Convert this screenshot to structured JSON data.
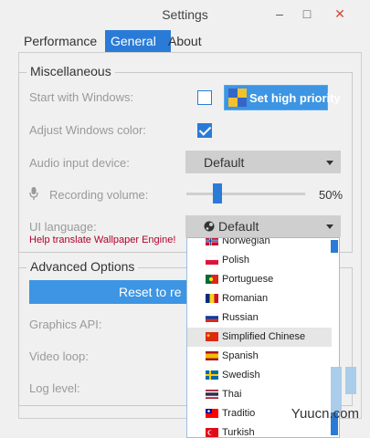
{
  "window": {
    "title": "Settings",
    "minimize": "–",
    "maximize": "□",
    "close": "✕"
  },
  "tabs": [
    {
      "label": "Performance",
      "active": false
    },
    {
      "label": "General",
      "active": true
    },
    {
      "label": "About",
      "active": false
    }
  ],
  "misc": {
    "legend": "Miscellaneous",
    "start_with_windows": {
      "label": "Start with Windows:",
      "checked": false
    },
    "high_priority_button": "Set high priority",
    "adjust_color": {
      "label": "Adjust Windows color:",
      "checked": true
    },
    "audio_device": {
      "label": "Audio input device:",
      "value": "Default"
    },
    "recording_volume": {
      "label": "Recording volume:",
      "value_text": "50%",
      "value": 0.26
    },
    "ui_language": {
      "label": "UI language:",
      "value": "Default"
    },
    "help_link": "Help translate Wallpaper Engine!"
  },
  "advanced": {
    "legend": "Advanced Options",
    "reset_button": "Reset to re",
    "graphics_api": "Graphics API:",
    "video_loop": "Video loop:",
    "log_level": "Log level:"
  },
  "language_list": {
    "items": [
      {
        "label": "Norwegian",
        "flag": "norway-flag"
      },
      {
        "label": "Polish",
        "flag": "poland-flag"
      },
      {
        "label": "Portuguese",
        "flag": "portugal-flag"
      },
      {
        "label": "Romanian",
        "flag": "romania-flag"
      },
      {
        "label": "Russian",
        "flag": "russia-flag"
      },
      {
        "label": "Simplified Chinese",
        "flag": "china-flag",
        "highlighted": true
      },
      {
        "label": "Spanish",
        "flag": "spain-flag"
      },
      {
        "label": "Swedish",
        "flag": "sweden-flag"
      },
      {
        "label": "Thai",
        "flag": "thailand-flag"
      },
      {
        "label": "Traditio",
        "flag": "taiwan-flag"
      },
      {
        "label": "Turkish",
        "flag": "turkey-flag"
      }
    ]
  },
  "watermark": "Yuucn.com",
  "colors": {
    "accent": "#2a7bd7",
    "button_blue": "#3d95e3",
    "help_link": "#b2002a"
  }
}
